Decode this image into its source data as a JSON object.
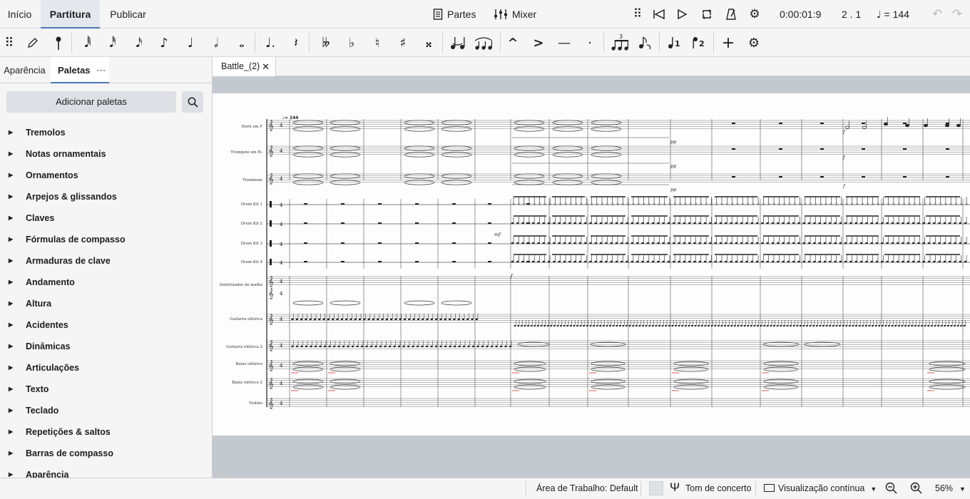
{
  "menu": {
    "tabs": [
      "Início",
      "Partitura",
      "Publicar"
    ]
  },
  "topbar": {
    "parts_label": "Partes",
    "mixer_label": "Mixer",
    "time": "0:00:01:9",
    "measure": "2 . 1",
    "tempo": "= 144"
  },
  "toolbar": {
    "icons": [
      "grip-icon",
      "pencil-icon",
      "accent-note-icon",
      "64th-note-icon",
      "32nd-note-icon",
      "16th-note-icon",
      "eighth-note-icon",
      "quarter-note-icon",
      "half-note-icon",
      "whole-note-icon",
      "dotted-note-icon",
      "rest-icon",
      "double-flat-icon",
      "flat-icon",
      "natural-icon",
      "sharp-icon",
      "double-sharp-icon",
      "tie-icon",
      "slur-icon",
      "marcato-icon",
      "accent-icon",
      "tenuto-icon",
      "staccato-icon",
      "tuplet-icon",
      "flip-icon",
      "voice-1-icon",
      "voice-2-icon",
      "add-icon",
      "settings-icon"
    ]
  },
  "sidebar": {
    "tabs": [
      "Aparência",
      "Paletas"
    ],
    "add_palettes": "Adicionar paletas",
    "palettes": [
      "Tremolos",
      "Notas ornamentais",
      "Ornamentos",
      "Arpejos & glissandos",
      "Claves",
      "Fórmulas de compasso",
      "Armaduras de clave",
      "Andamento",
      "Altura",
      "Acidentes",
      "Dinâmicas",
      "Articulações",
      "Texto",
      "Teclado",
      "Repetições & saltos",
      "Barras de compasso",
      "Aparência"
    ]
  },
  "document_tab": {
    "title": "Battle_(2)"
  },
  "score": {
    "tempo_marking": "♩= 144",
    "instruments": [
      "Horn em F",
      "Trompete em B♭",
      "Trombone",
      "Drum Kit 1",
      "Drum Kit 2",
      "Drum Kit 3",
      "Drum Kit 4",
      "Sintetizador de malha",
      "Guitarra elétrica",
      "Guitarra elétrica 2",
      "Baixo elétrico",
      "Baixo elétrico 2",
      "Violino"
    ],
    "dynamics": [
      "pp",
      "pp",
      "pp",
      "f",
      "f",
      "f",
      "mf",
      "f"
    ]
  },
  "statusbar": {
    "workspace": "Área de Trabalho: Default",
    "concert_pitch": "Tom de concerto",
    "view_mode": "Visualização contínua",
    "zoom": "56%"
  }
}
